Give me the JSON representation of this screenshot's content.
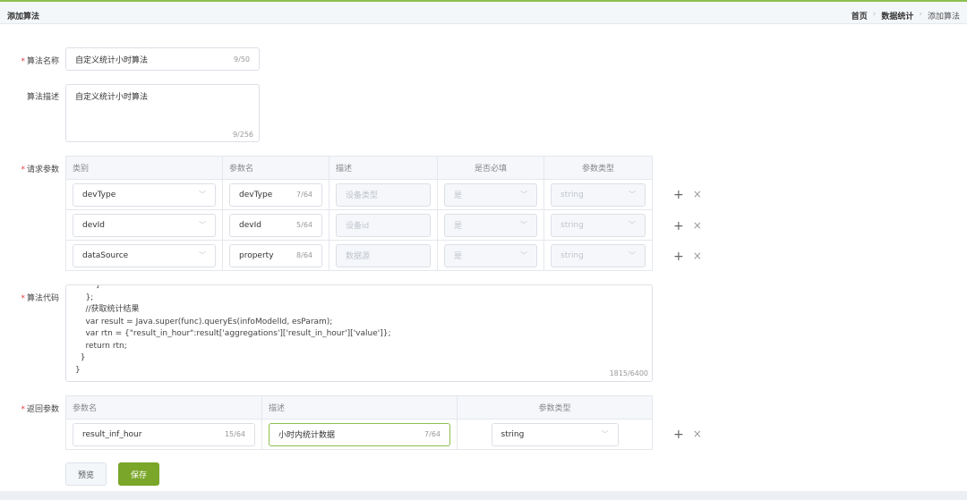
{
  "header": {
    "title": "添加算法",
    "breadcrumb": [
      "首页",
      "数据统计",
      "添加算法"
    ]
  },
  "form": {
    "name": {
      "label": "算法名称",
      "value": "自定义统计小时算法",
      "count": "9/50"
    },
    "desc": {
      "label": "算法描述",
      "value": "自定义统计小时算法",
      "count": "9/256"
    },
    "request": {
      "label": "请求参数",
      "headers": [
        "类别",
        "参数名",
        "描述",
        "是否必填",
        "参数类型"
      ],
      "rows": [
        {
          "category": "devType",
          "name": "devType",
          "count": "7/64",
          "desc": "设备类型",
          "required": "是",
          "type": "string"
        },
        {
          "category": "devId",
          "name": "devId",
          "count": "5/64",
          "desc": "设备id",
          "required": "是",
          "type": "string"
        },
        {
          "category": "dataSource",
          "name": "property",
          "count": "8/64",
          "desc": "数据源",
          "required": "是",
          "type": "string"
        }
      ]
    },
    "code": {
      "label": "算法代码",
      "value": "        }\n    };\n    //获取统计结果\n    var result = Java.super(func).queryEs(infoModelId, esParam);\n    var rtn = {\"result_in_hour\":result['aggregations']['result_in_hour']['value']};\n    return rtn;\n  }\n}",
      "count": "1815/6400"
    },
    "response": {
      "label": "返回参数",
      "headers": [
        "参数名",
        "描述",
        "参数类型"
      ],
      "rows": [
        {
          "name": "result_inf_hour",
          "name_count": "15/64",
          "desc": "小时内统计数据",
          "desc_count": "7/64",
          "type": "string"
        }
      ]
    }
  },
  "buttons": {
    "preview": "预览",
    "save": "保存"
  },
  "icons": {
    "add": "+",
    "remove": "×",
    "chevron": "﹀"
  },
  "colors": {
    "accent": "#7aa629",
    "required": "#e4393c"
  }
}
